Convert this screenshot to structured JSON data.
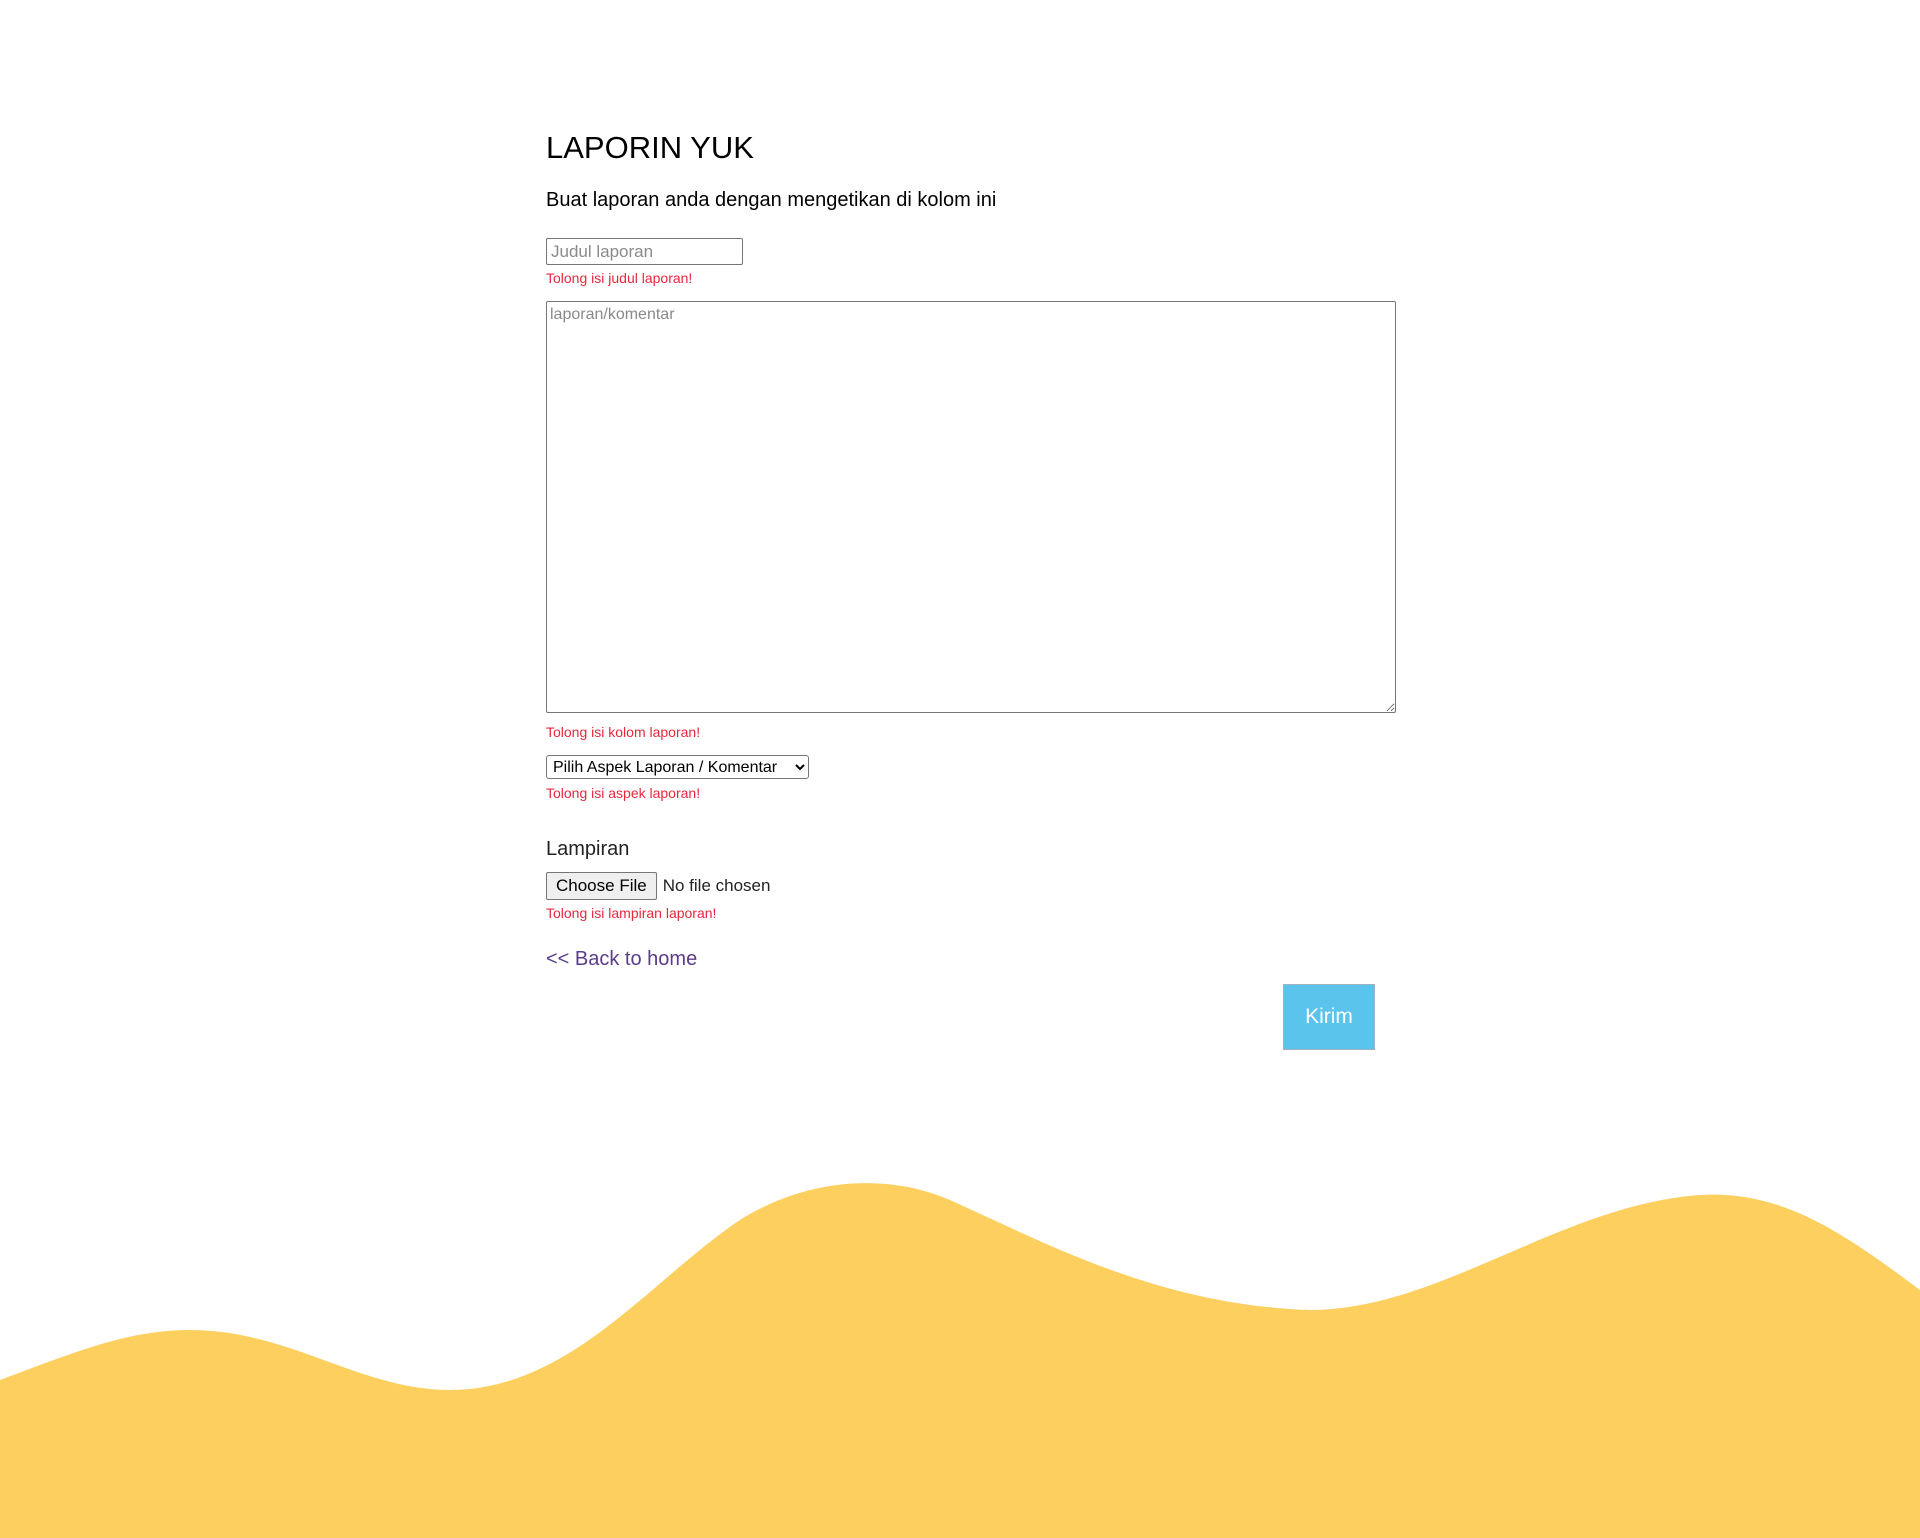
{
  "header": {
    "title": "LAPORIN YUK",
    "subtitle": "Buat laporan anda dengan mengetikan di kolom ini"
  },
  "form": {
    "title_field": {
      "placeholder": "Judul laporan",
      "value": "",
      "error": "Tolong isi judul laporan!"
    },
    "body_field": {
      "placeholder": "laporan/komentar",
      "value": "",
      "error": "Tolong isi kolom laporan!"
    },
    "aspect_select": {
      "selected": "Pilih Aspek Laporan / Komentar",
      "error": "Tolong isi aspek laporan!"
    },
    "attachment": {
      "label": "Lampiran",
      "button_label": "Choose File",
      "status": "No file chosen",
      "error": "Tolong isi lampiran laporan!"
    },
    "back_link": "<< Back to home",
    "submit_label": "Kirim"
  },
  "colors": {
    "error": "#e8283c",
    "submit_bg": "#5bc4ec",
    "link": "#5b3c8c",
    "wave": "#fdcf5e"
  }
}
